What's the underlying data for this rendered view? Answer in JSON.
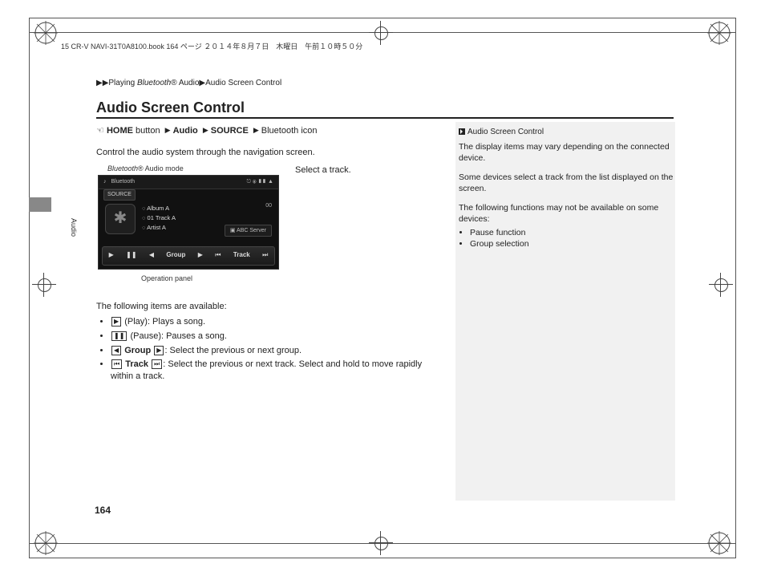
{
  "header": "15 CR-V NAVI-31T0A8100.book  164 ページ  ２０１４年８月７日　木曜日　午前１０時５０分",
  "breadcrumb": [
    "Playing ",
    "Bluetooth",
    "® Audio",
    "Audio Screen Control"
  ],
  "title": "Audio Screen Control",
  "side_label": "Audio",
  "nav": [
    "HOME",
    "button",
    "Audio",
    "SOURCE",
    "Bluetooth icon"
  ],
  "intro": "Control the audio system through the navigation screen.",
  "labels": {
    "mode_prefix": "Bluetooth",
    "mode_suffix": "® Audio mode",
    "select_track": "Select a track.",
    "op_panel": "Operation panel"
  },
  "screen": {
    "top_label": "Bluetooth",
    "status": "⎋ ⦿ ▮▮ ▲",
    "source_btn": "SOURCE",
    "rows": [
      "Album A",
      "01  Track A",
      "Artist A"
    ],
    "counter": "00",
    "server": "ABC Server",
    "panel": {
      "group": "Group",
      "track": "Track"
    }
  },
  "items": {
    "heading": "The following items are available:",
    "group_word": "Group",
    "track_word": "Track",
    "list": [
      "(Play): Plays a song.",
      "(Pause): Pauses a song.",
      ": Select the previous or next group.",
      ": Select the previous or next track. Select and hold to move rapidly",
      "within a track."
    ]
  },
  "notes": {
    "title": "Audio Screen Control",
    "p1": "The display items may vary depending on the connected device.",
    "p2": "Some devices select a track from the list displayed on the screen.",
    "p3": "The following functions may not be available on some devices:",
    "bullets": [
      "Pause function",
      "Group selection"
    ]
  },
  "page_number": "164"
}
